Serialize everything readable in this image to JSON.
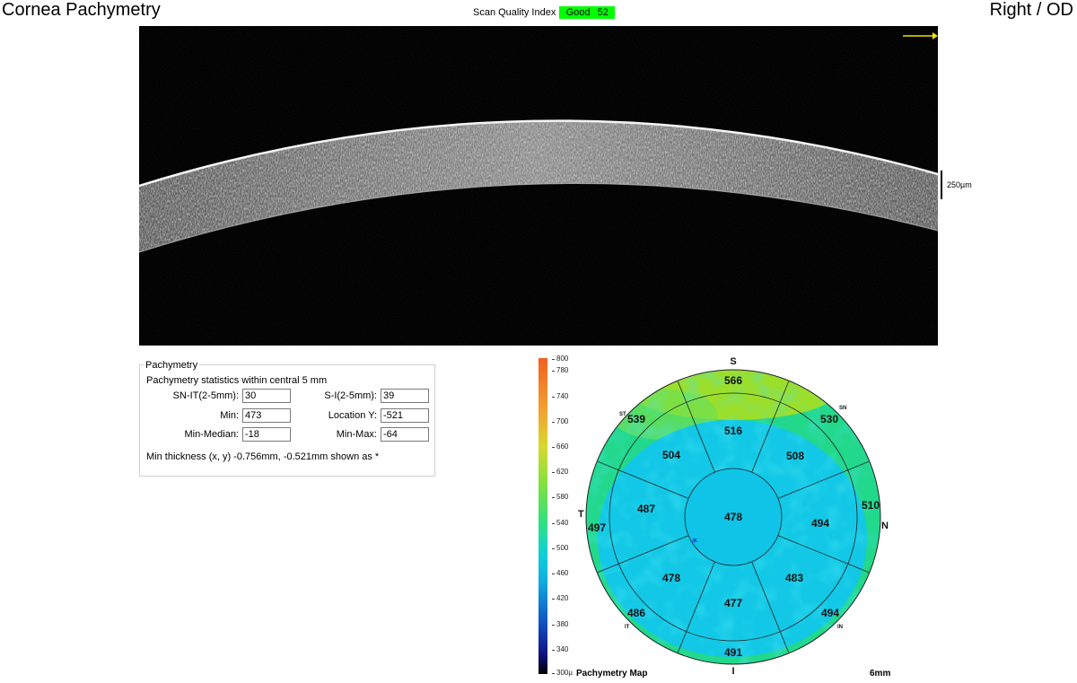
{
  "header": {
    "title": "Cornea Pachymetry",
    "eye": "Right / OD",
    "sqi_label": "Scan Quality Index",
    "sqi_status": "Good",
    "sqi_value": "52"
  },
  "scan": {
    "scale_label": "250µm"
  },
  "pachymetry": {
    "legend": "Pachymetry",
    "subtitle": "Pachymetry statistics within central 5 mm",
    "fields": [
      {
        "label": "SN-IT(2-5mm):",
        "value": "30"
      },
      {
        "label": "S-I(2-5mm):",
        "value": "39"
      },
      {
        "label": "Min:",
        "value": "473"
      },
      {
        "label": "Location Y:",
        "value": "-521"
      },
      {
        "label": "Min-Median:",
        "value": "-18"
      },
      {
        "label": "Min-Max:",
        "value": "-64"
      }
    ],
    "note": "Min thickness (x, y) -0.756mm, -0.521mm shown as *"
  },
  "colorbar": {
    "ticks": [
      "800",
      "780",
      "740",
      "700",
      "660",
      "620",
      "580",
      "540",
      "500",
      "460",
      "420",
      "380",
      "340",
      "300µ"
    ]
  },
  "map": {
    "label": "Pachymetry Map",
    "size_label": "6mm",
    "orientation": {
      "S": "S",
      "I": "I",
      "T": "T",
      "N": "N",
      "ST": "ST",
      "SN": "SN",
      "IT": "IT",
      "IN": "IN"
    },
    "center": "478",
    "inner": {
      "S": "516",
      "SN": "508",
      "N": "494",
      "IN": "483",
      "I": "477",
      "IT": "478",
      "T": "487",
      "ST": "504"
    },
    "outer": {
      "S": "566",
      "SN": "530",
      "N": "510",
      "IN": "494",
      "I": "491",
      "IT": "486",
      "T": "497",
      "ST": "539"
    },
    "colors": {
      "thick": "#a8e020",
      "mid": "#22d88a",
      "thin": "#12c8e6",
      "center": "#10c4e8"
    }
  }
}
